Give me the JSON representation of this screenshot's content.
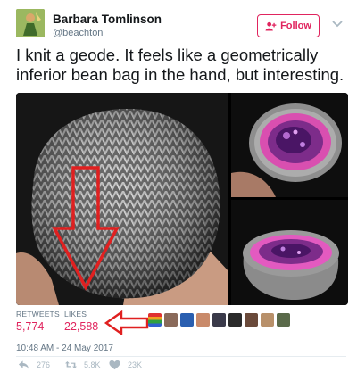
{
  "user": {
    "name": "Barbara Tomlinson",
    "handle": "@beachton"
  },
  "header": {
    "follow_label": "Follow"
  },
  "tweet": {
    "text": "I knit a geode. It feels like a geometrically inferior bean bag in the hand, but interesting."
  },
  "stats": {
    "retweets_label": "RETWEETS",
    "retweets_value": "5,774",
    "likes_label": "LIKES",
    "likes_value": "22,588"
  },
  "timestamp": "10:48 AM - 24 May 2017",
  "actions": {
    "reply_count": "276",
    "retweet_count": "5.8K",
    "like_count": "23K"
  },
  "colors": {
    "accent": "#e0245e",
    "muted": "#657786",
    "annotation_red": "#e02020"
  },
  "icons": [
    "follow-person-icon",
    "chevron-down-icon",
    "reply-icon",
    "retweet-icon",
    "heart-icon"
  ]
}
